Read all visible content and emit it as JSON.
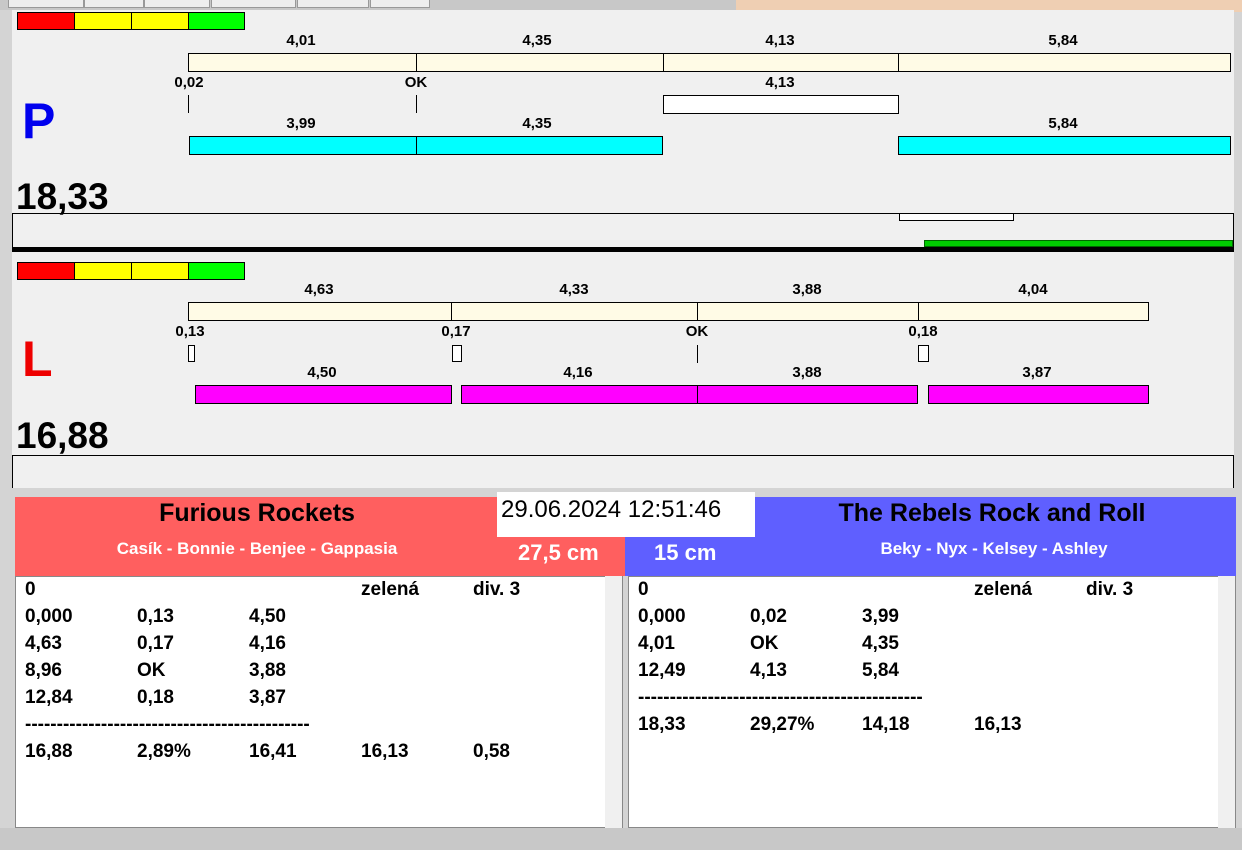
{
  "right_lane": {
    "letter": "P",
    "total": "18,33",
    "seg_labels": [
      "4,01",
      "4,35",
      "4,13",
      "5,84"
    ],
    "marks": [
      "0,02",
      "OK"
    ],
    "white_label": "4,13",
    "cyan_labels": [
      "3,99",
      "4,35",
      "5,84"
    ]
  },
  "left_lane": {
    "letter": "L",
    "total": "16,88",
    "seg_labels": [
      "4,63",
      "4,33",
      "3,88",
      "4,04"
    ],
    "marks": [
      "0,13",
      "0,17",
      "OK",
      "0,18"
    ],
    "magenta_labels": [
      "4,50",
      "4,16",
      "3,88",
      "3,87"
    ]
  },
  "datetime": "29.06.2024 12:51:46",
  "team_left": {
    "name": "Furious Rockets",
    "members": "Casík - Bonnie - Benjee - Gappasia",
    "distance": "27,5 cm",
    "color": "#ff5f5f",
    "rows": [
      [
        "0",
        "",
        "",
        "zelená",
        "div. 3"
      ],
      [
        "0,000",
        "0,13",
        "4,50"
      ],
      [
        "4,63",
        "0,17",
        "4,16"
      ],
      [
        "8,96",
        "OK",
        "3,88"
      ],
      [
        "12,84",
        "0,18",
        "3,87"
      ],
      [
        "---------------------------------------------"
      ],
      [
        "16,88",
        "2,89%",
        "16,41",
        "16,13",
        "0,58"
      ]
    ]
  },
  "team_right": {
    "name": "The Rebels Rock and Roll",
    "members": "Beky - Nyx - Kelsey - Ashley",
    "distance": "15 cm",
    "color": "#5f5fff",
    "rows": [
      [
        "0",
        "",
        "",
        "zelená",
        "div. 3"
      ],
      [
        "0,000",
        "0,02",
        "3,99"
      ],
      [
        "4,01",
        "OK",
        "4,35"
      ],
      [
        "12,49",
        "4,13",
        "5,84"
      ],
      [
        "---------------------------------------------"
      ],
      [
        "18,33",
        "29,27%",
        "14,18",
        "16,13"
      ]
    ]
  }
}
